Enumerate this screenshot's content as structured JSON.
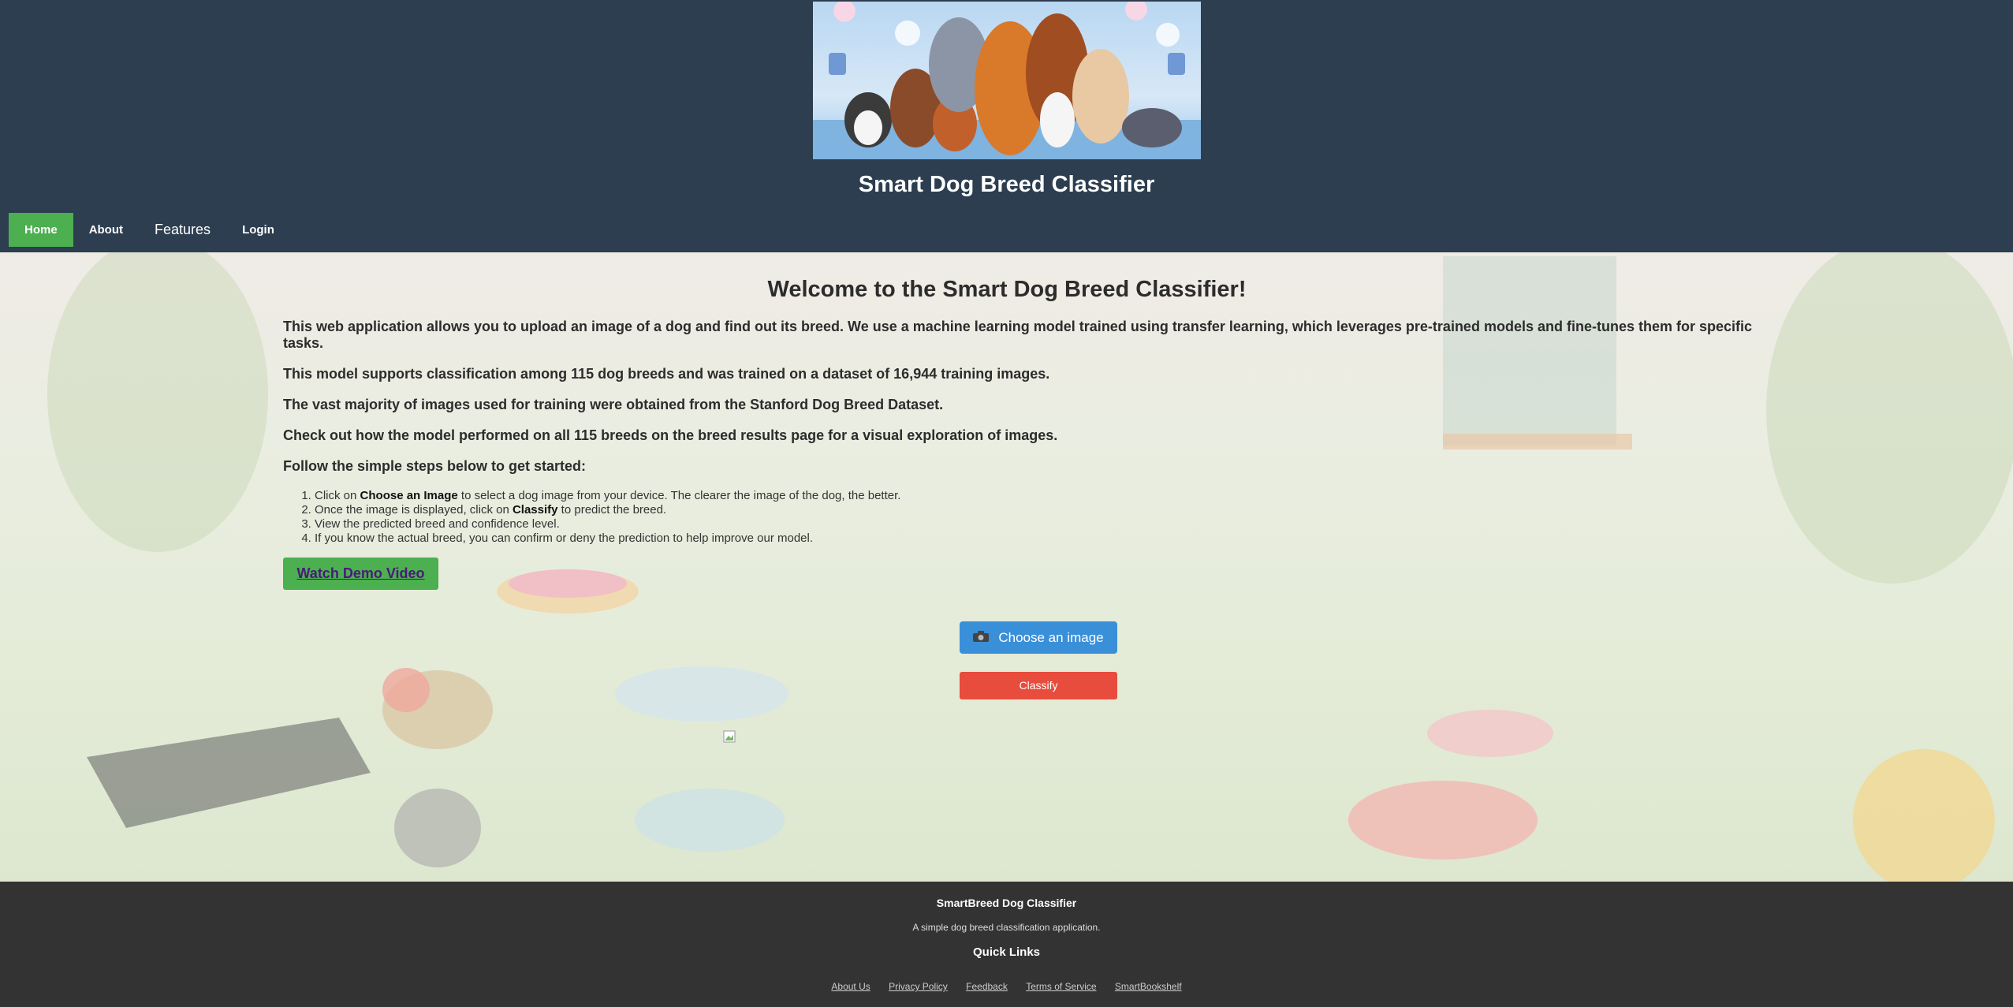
{
  "header": {
    "title": "Smart Dog Breed Classifier",
    "hero_image": "dog-breeds-illustration"
  },
  "nav": {
    "items": [
      {
        "label": "Home",
        "active": true
      },
      {
        "label": "About"
      },
      {
        "label": "Features"
      },
      {
        "label": "Login"
      }
    ]
  },
  "main": {
    "heading": "Welcome to the Smart Dog Breed Classifier!",
    "paragraphs": [
      "This web application allows you to upload an image of a dog and find out its breed. We use a machine learning model trained using transfer learning, which leverages pre-trained models and fine-tunes them for specific tasks.",
      "This model supports classification among 115 dog breeds and was trained on a dataset of 16,944 training images.",
      "The vast majority of images used for training were obtained from the Stanford Dog Breed Dataset.",
      "Check out how the model performed on all 115 breeds on the breed results page for a visual exploration of images.",
      "Follow the simple steps below to get started:"
    ],
    "steps": [
      {
        "pre": "Click on ",
        "bold": "Choose an Image",
        "post": " to select a dog image from your device. The clearer the image of the dog, the better."
      },
      {
        "pre": "Once the image is displayed, click on ",
        "bold": "Classify",
        "post": " to predict the breed."
      },
      {
        "pre": "View the predicted breed and confidence level.",
        "bold": "",
        "post": ""
      },
      {
        "pre": "If you know the actual breed, you can confirm or deny the prediction to help improve our model.",
        "bold": "",
        "post": ""
      }
    ],
    "demo_button": "Watch Demo Video",
    "choose_button": "Choose an image",
    "choose_icon": "camera-icon",
    "classify_button": "Classify"
  },
  "footer": {
    "title": "SmartBreed Dog Classifier",
    "description": "A simple dog breed classification application.",
    "quick_links_heading": "Quick Links",
    "links": [
      "About Us",
      "Privacy Policy",
      "Feedback",
      "Terms of Service",
      "SmartBookshelf"
    ]
  },
  "colors": {
    "header_bg": "#2c3e50",
    "nav_active": "#4caf50",
    "choose_button": "#3a8fd9",
    "classify_button": "#e74c3c",
    "footer_bg": "#333333"
  }
}
